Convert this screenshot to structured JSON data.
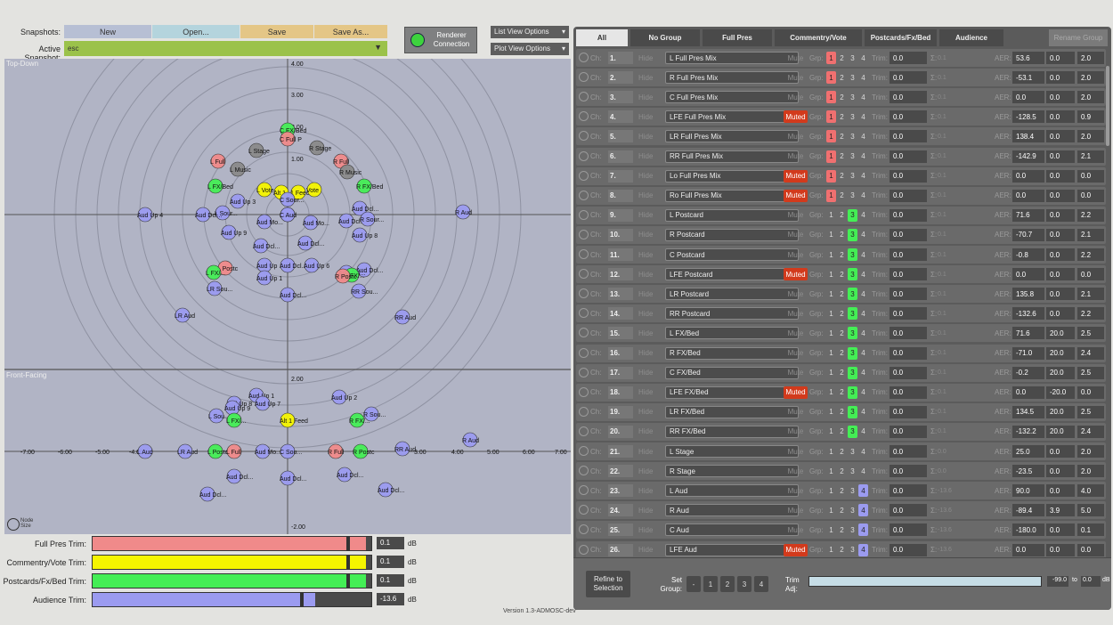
{
  "toolbar": {
    "snapshots_label": "Snapshots:",
    "new_label": "New",
    "open_label": "Open...",
    "save_label": "Save",
    "save_as_label": "Save As...",
    "active_label": "Active Snapshot:",
    "active_value": "esc",
    "renderer_label": "Renderer Connection",
    "list_view": "List View Options",
    "plot_view": "Plot View Options"
  },
  "plot": {
    "top_label": "Top-Down",
    "front_label": "Front-Facing",
    "node_size": "Node Size",
    "top_ticks": [
      "4.00",
      "3.00",
      "2.00",
      "1.00"
    ],
    "front_ticks": [
      "2.00",
      "-2.00"
    ],
    "x_ticks": [
      "-7.00",
      "-6.00",
      "-5.00",
      "-4.00",
      "3.00",
      "4.00",
      "5.00",
      "6.00",
      "7.00"
    ]
  },
  "trims": [
    {
      "label": "Full Pres Trim:",
      "value": "0.1",
      "unit": "dB",
      "fill": 0.98,
      "color": "#f08a8a"
    },
    {
      "label": "Commentry/Vote Trim:",
      "value": "0.1",
      "unit": "dB",
      "fill": 0.98,
      "color": "#f5f500"
    },
    {
      "label": "Postcards/Fx/Bed Trim:",
      "value": "0.1",
      "unit": "dB",
      "fill": 0.98,
      "color": "#44ee55"
    },
    {
      "label": "Audience Trim:",
      "value": "-13.6",
      "unit": "dB",
      "fill": 0.8,
      "color": "#9b9bf0"
    }
  ],
  "version": "Version 1.3-ADMOSC-dev",
  "tabs": [
    "All",
    "No Group",
    "Full Pres",
    "Commentry/Vote",
    "Postcards/Fx/Bed",
    "Audience",
    "Rename Group"
  ],
  "row_labels": {
    "ch": "Ch:",
    "hide": "Hide",
    "mute": "Mute",
    "muted": "Muted",
    "grp": "Grp:",
    "trim": "Trim:",
    "sigma": "Σ:",
    "aer": "AER:"
  },
  "channels": [
    {
      "n": "1.",
      "name": "L Full Pres Mix",
      "muted": false,
      "grp": 1,
      "trim": "0.0",
      "sum": "0.1",
      "a": "53.6",
      "e": "0.0",
      "r": "2.0"
    },
    {
      "n": "2.",
      "name": "R Full Pres Mix",
      "muted": false,
      "grp": 1,
      "trim": "0.0",
      "sum": "0.1",
      "a": "-53.1",
      "e": "0.0",
      "r": "2.0"
    },
    {
      "n": "3.",
      "name": "C Full Pres Mix",
      "muted": false,
      "grp": 1,
      "trim": "0.0",
      "sum": "0.1",
      "a": "0.0",
      "e": "0.0",
      "r": "2.0"
    },
    {
      "n": "4.",
      "name": "LFE Full Pres Mix",
      "muted": true,
      "grp": 1,
      "trim": "0.0",
      "sum": "0.1",
      "a": "-128.5",
      "e": "0.0",
      "r": "0.9"
    },
    {
      "n": "5.",
      "name": "LR Full Pres Mix",
      "muted": false,
      "grp": 1,
      "trim": "0.0",
      "sum": "0.1",
      "a": "138.4",
      "e": "0.0",
      "r": "2.0"
    },
    {
      "n": "6.",
      "name": "RR Full Pres Mix",
      "muted": false,
      "grp": 1,
      "trim": "0.0",
      "sum": "0.1",
      "a": "-142.9",
      "e": "0.0",
      "r": "2.1"
    },
    {
      "n": "7.",
      "name": "Lo Full Pres Mix",
      "muted": true,
      "grp": 1,
      "trim": "0.0",
      "sum": "0.1",
      "a": "0.0",
      "e": "0.0",
      "r": "0.0"
    },
    {
      "n": "8.",
      "name": "Ro Full Pres Mix",
      "muted": true,
      "grp": 1,
      "trim": "0.0",
      "sum": "0.1",
      "a": "0.0",
      "e": "0.0",
      "r": "0.0"
    },
    {
      "n": "9.",
      "name": "L Postcard",
      "muted": false,
      "grp": 3,
      "trim": "0.0",
      "sum": "0.1",
      "a": "71.6",
      "e": "0.0",
      "r": "2.2"
    },
    {
      "n": "10.",
      "name": "R Postcard",
      "muted": false,
      "grp": 3,
      "trim": "0.0",
      "sum": "0.1",
      "a": "-70.7",
      "e": "0.0",
      "r": "2.1"
    },
    {
      "n": "11.",
      "name": "C Postcard",
      "muted": false,
      "grp": 3,
      "trim": "0.0",
      "sum": "0.1",
      "a": "-0.8",
      "e": "0.0",
      "r": "2.2"
    },
    {
      "n": "12.",
      "name": "LFE Postcard",
      "muted": true,
      "grp": 3,
      "trim": "0.0",
      "sum": "0.1",
      "a": "0.0",
      "e": "0.0",
      "r": "0.0"
    },
    {
      "n": "13.",
      "name": "LR Postcard",
      "muted": false,
      "grp": 3,
      "trim": "0.0",
      "sum": "0.1",
      "a": "135.8",
      "e": "0.0",
      "r": "2.1"
    },
    {
      "n": "14.",
      "name": "RR Postcard",
      "muted": false,
      "grp": 3,
      "trim": "0.0",
      "sum": "0.1",
      "a": "-132.6",
      "e": "0.0",
      "r": "2.2"
    },
    {
      "n": "15.",
      "name": "L FX/Bed",
      "muted": false,
      "grp": 3,
      "trim": "0.0",
      "sum": "0.1",
      "a": "71.6",
      "e": "20.0",
      "r": "2.5"
    },
    {
      "n": "16.",
      "name": "R FX/Bed",
      "muted": false,
      "grp": 3,
      "trim": "0.0",
      "sum": "0.1",
      "a": "-71.0",
      "e": "20.0",
      "r": "2.4"
    },
    {
      "n": "17.",
      "name": "C FX/Bed",
      "muted": false,
      "grp": 3,
      "trim": "0.0",
      "sum": "0.1",
      "a": "-0.2",
      "e": "20.0",
      "r": "2.5"
    },
    {
      "n": "18.",
      "name": "LFE FX/Bed",
      "muted": true,
      "grp": 3,
      "trim": "0.0",
      "sum": "0.1",
      "a": "0.0",
      "e": "-20.0",
      "r": "0.0"
    },
    {
      "n": "19.",
      "name": "LR FX/Bed",
      "muted": false,
      "grp": 3,
      "trim": "0.0",
      "sum": "0.1",
      "a": "134.5",
      "e": "20.0",
      "r": "2.5"
    },
    {
      "n": "20.",
      "name": "RR FX/Bed",
      "muted": false,
      "grp": 3,
      "trim": "0.0",
      "sum": "0.1",
      "a": "-132.2",
      "e": "20.0",
      "r": "2.4"
    },
    {
      "n": "21.",
      "name": "L Stage",
      "muted": false,
      "grp": 0,
      "trim": "0.0",
      "sum": "0.0",
      "a": "25.0",
      "e": "0.0",
      "r": "2.0"
    },
    {
      "n": "22.",
      "name": "R Stage",
      "muted": false,
      "grp": 0,
      "trim": "0.0",
      "sum": "0.0",
      "a": "-23.5",
      "e": "0.0",
      "r": "2.0"
    },
    {
      "n": "23.",
      "name": "L Aud",
      "muted": false,
      "grp": 4,
      "trim": "0.0",
      "sum": "-13.6",
      "a": "90.0",
      "e": "0.0",
      "r": "4.0"
    },
    {
      "n": "24.",
      "name": "R Aud",
      "muted": false,
      "grp": 4,
      "trim": "0.0",
      "sum": "-13.6",
      "a": "-89.4",
      "e": "3.9",
      "r": "5.0"
    },
    {
      "n": "25.",
      "name": "C Aud",
      "muted": false,
      "grp": 4,
      "trim": "0.0",
      "sum": "-13.6",
      "a": "-180.0",
      "e": "0.0",
      "r": "0.1"
    },
    {
      "n": "26.",
      "name": "LFE Aud",
      "muted": true,
      "grp": 4,
      "trim": "0.0",
      "sum": "-13.6",
      "a": "0.0",
      "e": "0.0",
      "r": "0.0"
    }
  ],
  "bottom": {
    "refine": "Refine to Selection",
    "set_group": "Set Group:",
    "grp_buttons": [
      "-",
      "1",
      "2",
      "3",
      "4"
    ],
    "trim_adj": "Trim Adj:",
    "range_from": "-99.0",
    "to": "to",
    "range_to": "0.0",
    "unit": "dB"
  },
  "colors": {
    "grp1": "#f07070",
    "grp3": "#44ee55",
    "grp4": "#9b9bf0",
    "muted": "#d23a1c",
    "fullpres": "#f08a8a",
    "vote": "#f5f500",
    "fx": "#44ee55",
    "aud": "#9b9bf0",
    "stage": "#8a8a8a"
  },
  "top_nodes": [
    {
      "t": "C FX/Bed",
      "c": "fx"
    },
    {
      "t": "C Full P",
      "c": "fullpres"
    },
    {
      "t": "L Stage",
      "c": "stage"
    },
    {
      "t": "R Stage",
      "c": "stage"
    },
    {
      "t": "L Full",
      "c": "fullpres"
    },
    {
      "t": "L Music",
      "c": "stage"
    },
    {
      "t": "R Full",
      "c": "fullpres"
    },
    {
      "t": "R Music",
      "c": "stage"
    },
    {
      "t": "L FX/Bed",
      "c": "fx"
    },
    {
      "t": "R FX/Bed",
      "c": "fx"
    },
    {
      "t": "L Vote",
      "c": "vote"
    },
    {
      "t": "Alt 1",
      "c": "vote"
    },
    {
      "t": "1 Feed",
      "c": "vote"
    },
    {
      "t": "Vote",
      "c": "vote"
    },
    {
      "t": "C Sour...",
      "c": "aud"
    },
    {
      "t": "L Aud",
      "c": "aud"
    },
    {
      "t": "R Aud",
      "c": "aud"
    },
    {
      "t": "Aud Up 4",
      "c": "aud"
    },
    {
      "t": "Aud Up 3",
      "c": "aud"
    },
    {
      "t": "Aud Dcl...",
      "c": "aud"
    },
    {
      "t": "L Sour...",
      "c": "aud"
    },
    {
      "t": "Aud Dcl...",
      "c": "aud"
    },
    {
      "t": "C Aud",
      "c": "aud"
    },
    {
      "t": "Aud Mo...",
      "c": "aud"
    },
    {
      "t": "Aud Mo...",
      "c": "aud"
    },
    {
      "t": "Aud Dcl...",
      "c": "aud"
    },
    {
      "t": "R Sour...",
      "c": "aud"
    },
    {
      "t": "Aud Up 9",
      "c": "aud"
    },
    {
      "t": "Aud Up 8",
      "c": "aud"
    },
    {
      "t": "Aud Dcl...",
      "c": "aud"
    },
    {
      "t": "Aud Dcl...",
      "c": "aud"
    },
    {
      "t": "L Postc",
      "c": "fullpres"
    },
    {
      "t": "L FX/...",
      "c": "fx"
    },
    {
      "t": "Aud Up",
      "c": "aud"
    },
    {
      "t": "Aud Dcl...",
      "c": "aud"
    },
    {
      "t": "Aud Up 6",
      "c": "aud"
    },
    {
      "t": "Aud Dcl...",
      "c": "aud"
    },
    {
      "t": "Aud Dcl...",
      "c": "aud"
    },
    {
      "t": "R FX/...",
      "c": "fx"
    },
    {
      "t": "R Postc",
      "c": "fullpres"
    },
    {
      "t": "Aud Up 1",
      "c": "aud"
    },
    {
      "t": "LR Sou...",
      "c": "aud"
    },
    {
      "t": "Aud Dcl...",
      "c": "aud"
    },
    {
      "t": "RR Sou...",
      "c": "aud"
    },
    {
      "t": "LR Aud",
      "c": "aud"
    },
    {
      "t": "RR Aud",
      "c": "aud"
    }
  ],
  "front_nodes": [
    {
      "t": "Aud Up 1",
      "c": "aud"
    },
    {
      "t": "Aud Up 2",
      "c": "aud"
    },
    {
      "t": "Aud Up 8",
      "c": "aud"
    },
    {
      "t": "Aud Up 7",
      "c": "aud"
    },
    {
      "t": "Aud Up 9",
      "c": "aud"
    },
    {
      "t": "L Sou...",
      "c": "aud"
    },
    {
      "t": "L FX/...",
      "c": "fx"
    },
    {
      "t": "Alt 1 Feed",
      "c": "vote"
    },
    {
      "t": "R FX/...",
      "c": "fx"
    },
    {
      "t": "R Sou...",
      "c": "aud"
    },
    {
      "t": "R Aud",
      "c": "aud"
    },
    {
      "t": "L Aud",
      "c": "aud"
    },
    {
      "t": "LR Aud",
      "c": "aud"
    },
    {
      "t": "L Postc",
      "c": "fx"
    },
    {
      "t": "L Full",
      "c": "fullpres"
    },
    {
      "t": "Aud Mo...",
      "c": "aud"
    },
    {
      "t": "C Sou...",
      "c": "aud"
    },
    {
      "t": "R Full",
      "c": "fullpres"
    },
    {
      "t": "R Postc",
      "c": "fx"
    },
    {
      "t": "RR Aud",
      "c": "aud"
    },
    {
      "t": "Aud Dcl...",
      "c": "aud"
    },
    {
      "t": "Aud Dcl...",
      "c": "aud"
    },
    {
      "t": "Aud Dcl...",
      "c": "aud"
    },
    {
      "t": "Aud Dcl...",
      "c": "aud"
    },
    {
      "t": "Aud Dcl...",
      "c": "aud"
    }
  ]
}
